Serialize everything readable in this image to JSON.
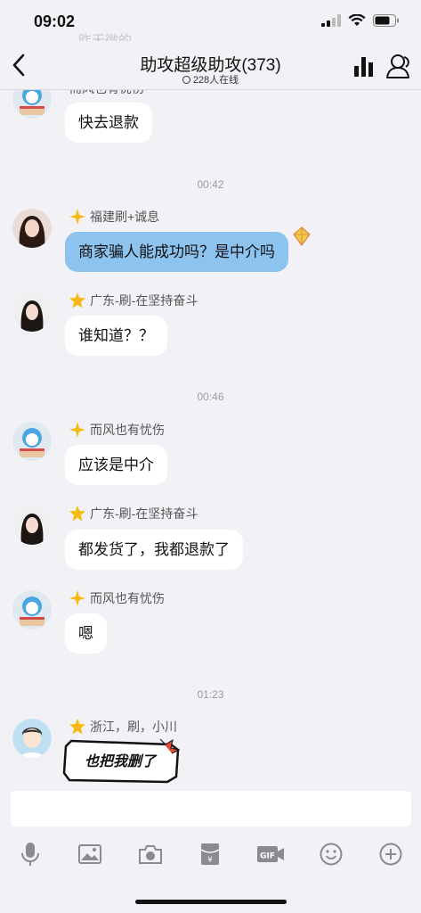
{
  "status": {
    "time": "09:02"
  },
  "faded_prev_text": "昨天微的",
  "header": {
    "title": "助攻超级助攻(373)",
    "online": "228人在线"
  },
  "messages": [
    {
      "type": "msg",
      "sender": "而风也有忧伤",
      "text": "快去退款",
      "avatar": "cake-avatar"
    },
    {
      "type": "time",
      "text": "00:42"
    },
    {
      "type": "msg",
      "sender": "福建刷+诚息",
      "text": "商家骗人能成功吗？是中介吗",
      "avatar": "girl-avatar",
      "special": true
    },
    {
      "type": "msg",
      "sender": "广东-刷-在坚持奋斗",
      "text": "谁知道？？",
      "avatar": "woman-avatar"
    },
    {
      "type": "time",
      "text": "00:46"
    },
    {
      "type": "msg",
      "sender": "而风也有忧伤",
      "text": "应该是中介",
      "avatar": "cake-avatar"
    },
    {
      "type": "msg",
      "sender": "广东-刷-在坚持奋斗",
      "text": "都发货了，我都退款了",
      "avatar": "woman-avatar"
    },
    {
      "type": "msg",
      "sender": "而风也有忧伤",
      "text": "嗯",
      "avatar": "cake-avatar"
    },
    {
      "type": "time",
      "text": "01:23"
    },
    {
      "type": "sticker",
      "sender": "浙江，刷，小川",
      "text": "也把我删了",
      "avatar": "boy-avatar"
    }
  ],
  "toolbar_icons": [
    "mic-icon",
    "image-icon",
    "camera-icon",
    "red-packet-icon",
    "gif-icon",
    "emoji-icon",
    "plus-icon"
  ],
  "colors": {
    "special_bubble": "#8dc3ef",
    "background": "#f2f2f6",
    "star": "#f5b90f"
  }
}
